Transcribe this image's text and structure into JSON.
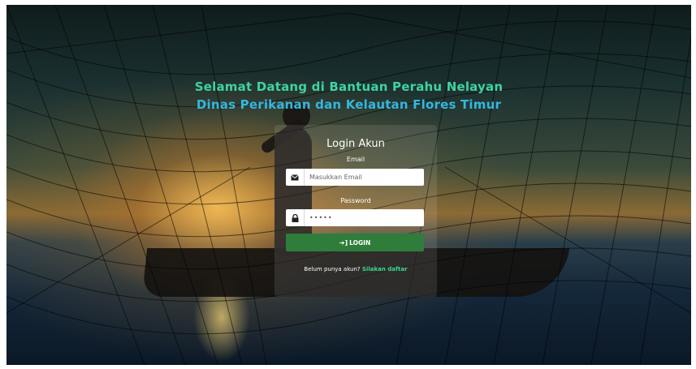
{
  "heading": {
    "line1": "Selamat Datang di Bantuan Perahu Nelayan",
    "line2": "Dinas Perikanan dan Kelautan Flores Timur"
  },
  "login": {
    "title": "Login Akun",
    "email_label": "Email",
    "email_placeholder": "Masukkan Email",
    "password_label": "Password",
    "password_value": "•••••",
    "button_label": "LOGIN",
    "register_prompt": "Belum punya akun?",
    "register_link": "Silakan daftar"
  },
  "icons": {
    "email": "envelope-icon",
    "password": "lock-icon",
    "login": "sign-in-icon"
  },
  "colors": {
    "heading_line1": "#3fd3a0",
    "heading_line2": "#34b7df",
    "button": "#2f7d3a",
    "link": "#39d98a"
  }
}
